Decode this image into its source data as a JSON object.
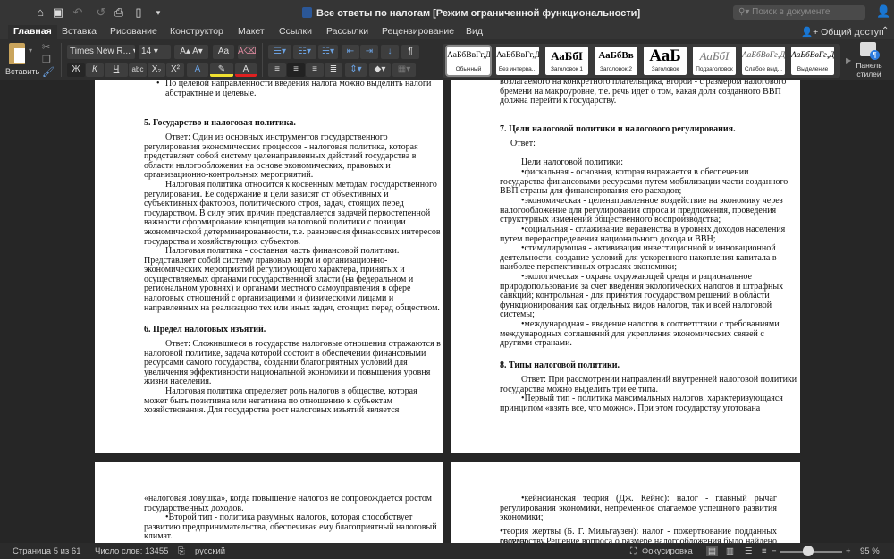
{
  "window": {
    "title": "Все ответы по налогам [Режим ограниченной функциональности]",
    "search_placeholder": "Поиск в документе"
  },
  "tabs": [
    "Главная",
    "Вставка",
    "Рисование",
    "Конструктор",
    "Макет",
    "Ссылки",
    "Рассылки",
    "Рецензирование",
    "Вид"
  ],
  "share_label": "Общий доступ",
  "ribbon": {
    "paste_label": "Вставить",
    "font_name": "Times New R...",
    "font_size": "14",
    "bold": "Ж",
    "italic": "К",
    "underline": "Ч",
    "strike": "abc",
    "subscript": "X₂",
    "superscript": "X²",
    "styles": [
      {
        "sample": "АаБбВвГг,Д",
        "name": "Обычный"
      },
      {
        "sample": "АаБбВвГг,Д",
        "name": "Без интерва..."
      },
      {
        "sample": "АаБбІ",
        "name": "Заголовок 1"
      },
      {
        "sample": "АаБбВв",
        "name": "Заголовок 2"
      },
      {
        "sample": "АаБ",
        "name": "Заголовок"
      },
      {
        "sample": "АаБбІ",
        "name": "Подзаголовок"
      },
      {
        "sample": "АаБбВвГг,Д",
        "name": "Слабое выд..."
      },
      {
        "sample": "АаБбВвГг,Д",
        "name": "Выделение"
      }
    ],
    "styles_pane_label": "Панель стилей"
  },
  "pages": [
    {
      "blocks": [
        {
          "kind": "bullet",
          "lines": [
            "По целевой направленности введения налога можно выделить налоги",
            "абстрактные и целевые."
          ]
        },
        {
          "kind": "heading",
          "lines": [
            "5.  Государство и налоговая политика."
          ]
        },
        {
          "kind": "para",
          "lines": [
            "Ответ: Один из основных инструментов государственного",
            "регулирования экономических процессов - налоговая политика, которая",
            "представляет собой систему целенаправленных действий государства в",
            "области налогообложения на основе экономических, правовых и",
            "организационно-контрольных мероприятий."
          ]
        },
        {
          "kind": "para",
          "lines": [
            "Налоговая политика относится к косвенным методам государственного",
            "регулирования. Ее содержание и цели зависят от объективных и",
            "субъективных факторов, политического строя, задач, стоящих перед",
            "государством. В силу этих причин представляется задачей первостепенной",
            "важности сформирование концепции налоговой политики с позиции",
            "экономической детерминированности, т.е. равновесия финансовых интересов",
            "государства и хозяйствующих субъектов."
          ]
        },
        {
          "kind": "para",
          "lines": [
            "Налоговая политика - составная часть финансовой политики.",
            "Представляет собой систему правовых норм и организационно-",
            "экономических мероприятий регулирующего характера, принятых и",
            "осуществляемых органами государственной власти (на федеральном и",
            "региональном уровнях) и органами местного самоуправления в сфере",
            "налоговых отношений с организациями и физическими лицами и",
            "направленных на реализацию тех или иных задач, стоящих перед обществом."
          ]
        },
        {
          "kind": "heading",
          "lines": [
            "6.  Предел налоговых изъятий."
          ]
        },
        {
          "kind": "para",
          "lines": [
            "Ответ: Сложившиеся в государстве налоговые отношения отражаются в",
            "налоговой политике, задача которой состоит в обеспечении финансовыми",
            "ресурсами самого государства, создании благоприятных условий для",
            "увеличения эффективности национальной экономики и повышения уровня",
            "жизни населения."
          ]
        },
        {
          "kind": "para",
          "lines": [
            "Налоговая политика определяет роль налогов в обществе, которая",
            "может быть позитивна или негативна по отношению к субъектам",
            "хозяйствования. Для государства рост налоговых изъятий является"
          ]
        }
      ]
    },
    {
      "blocks": [
        {
          "kind": "cont",
          "lines": [
            "возлагаемого на конкретного плательщика, второй - с размером налогового",
            "бремени на макроуровне, т.е. речь идет о том, какая доля созданного ВВП",
            "должна перейти к государству."
          ]
        },
        {
          "kind": "heading",
          "lines": [
            "7.  Цели налоговой политики и налогового регулирования."
          ]
        },
        {
          "kind": "answer",
          "lines": [
            "Ответ:"
          ]
        },
        {
          "kind": "para",
          "lines": [
            "Цели налоговой политики:"
          ]
        },
        {
          "kind": "para",
          "lines": [
            "•фискальная - основная, которая выражается в обеспечении",
            "государства финансовыми ресурсами путем мобилизации части созданного",
            "ВВП страны для финансирования его расходов;"
          ]
        },
        {
          "kind": "para",
          "lines": [
            "•экономическая - целенаправленное воздействие на экономику через",
            "налогообложение для регулирования спроса и предложения, проведения",
            "структурных изменений общественного воспроизводства;"
          ]
        },
        {
          "kind": "para",
          "lines": [
            "•социальная - сглаживание неравенства в уровнях доходов населения",
            "путем перераспределения национального дохода и ВВН;"
          ]
        },
        {
          "kind": "para",
          "lines": [
            "•стимулирующая - активизация инвестиционной и инновационной",
            "деятельности, создание условий для ускоренного накопления капитала в",
            "наиболее перспективных отраслях экономики;"
          ]
        },
        {
          "kind": "para",
          "lines": [
            "•экологическая - охрана окружающей среды и рациональное",
            "природопользование за счет введения экологических налогов и штрафных",
            "санкций; контрольная - для принятия государством решений в области",
            "функционирования как отдельных видов налогов, так и всей налоговой",
            "системы;"
          ]
        },
        {
          "kind": "para",
          "lines": [
            "•международная - введение налогов в соответствии с требованиями",
            "международных соглашений для укрепления экономических связей с",
            "другими странами."
          ]
        },
        {
          "kind": "heading",
          "lines": [
            "8.  Типы налоговой политики."
          ]
        },
        {
          "kind": "para",
          "lines": [
            "Ответ: При рассмотрении направлений внутренней налоговой политики",
            "государства можно выделить три ее типа."
          ]
        },
        {
          "kind": "para",
          "lines": [
            "•Первый тип - политика максимальных налогов, характеризующаяся",
            "принципом «взять все, что можно». При этом государству уготована"
          ]
        }
      ]
    },
    {
      "blocks": [
        {
          "kind": "cont",
          "lines": [
            "«налоговая ловушка», когда повышение налогов не сопровождается ростом",
            "государственных доходов."
          ]
        },
        {
          "kind": "para",
          "lines": [
            "•Второй тип - политика разумных налогов, которая способствует",
            "развитию предпринимательства, обеспечивая ему благоприятный налоговый",
            "климат."
          ]
        }
      ]
    },
    {
      "blocks": [
        {
          "kind": "justified",
          "lines": [
            "•кейнсианская теория (Дж. Кейнс): налог - главный рычаг",
            "регулирования экономики, непременное слагаемое успешного развития",
            "экономики;"
          ]
        },
        {
          "kind": "cont",
          "lines": [
            "•теория жертвы (Б. Г. Мильгаузен): налог - пожертвование подданных своему",
            "государству.Решение вопроса о размере налогообложения было найдено"
          ]
        }
      ]
    }
  ],
  "status": {
    "page": "Страница 5 из 61",
    "words": "Число слов: 13455",
    "language": "русский",
    "focus": "Фокусировка",
    "zoom": "95 %",
    "zoom_percent": 95
  }
}
